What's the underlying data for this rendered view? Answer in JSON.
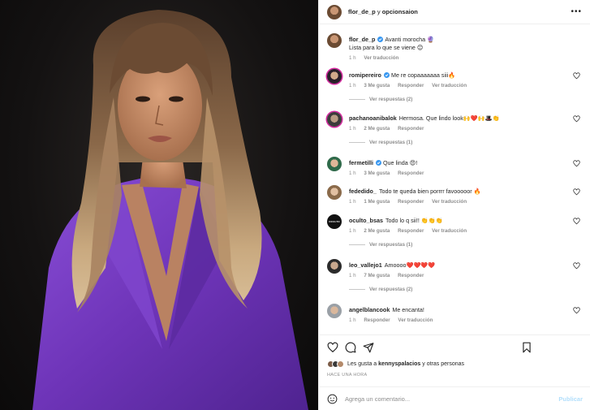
{
  "post": {
    "author": "flor_de_p",
    "collab_conjunction": "y",
    "collaborator": "opcionsaion",
    "more_icon": "more-horizontal-icon"
  },
  "caption": {
    "user": "flor_de_p",
    "text": "Avanti morocha 🔮",
    "text2": "Lista para lo que se viene 😊",
    "time": "1 h",
    "translate": "Ver traducción"
  },
  "comments": [
    {
      "user": "romipereiro",
      "verified": true,
      "text": "Me re copaaaaaaa siii🔥",
      "time": "1 h",
      "likes": "3 Me gusta",
      "reply": "Responder",
      "translate": "Ver traducción",
      "replies": "Ver respuestas (2)"
    },
    {
      "user": "pachanoanibalok",
      "verified": false,
      "text": "Hermosa. Que lindo look🙌❤️🙌🎩👏",
      "time": "1 h",
      "likes": "2 Me gusta",
      "reply": "Responder",
      "translate": "",
      "replies": "Ver respuestas (1)"
    },
    {
      "user": "fermetilli",
      "verified": true,
      "text": "Que linda 😍!",
      "time": "1 h",
      "likes": "3 Me gusta",
      "reply": "Responder",
      "translate": "",
      "replies": ""
    },
    {
      "user": "fededido_",
      "verified": false,
      "text": "Todo te queda bien porrrr favooooor 🔥",
      "time": "1 h",
      "likes": "1 Me gusta",
      "reply": "Responder",
      "translate": "Ver traducción",
      "replies": ""
    },
    {
      "user": "oculto_bsas",
      "verified": false,
      "text": "Todo lo q sii!! 👏👏👏",
      "time": "1 h",
      "likes": "2 Me gusta",
      "reply": "Responder",
      "translate": "Ver traducción",
      "replies": "Ver respuestas (1)"
    },
    {
      "user": "leo_vallejo1",
      "verified": false,
      "text": "Amoooo❤️❤️❤️❤️",
      "time": "1 h",
      "likes": "7 Me gusta",
      "reply": "Responder",
      "translate": "",
      "replies": "Ver respuestas (2)"
    },
    {
      "user": "angelblancook",
      "verified": false,
      "text": "Me encanta!",
      "time": "1 h",
      "likes": "",
      "reply": "Responder",
      "translate": "Ver traducción",
      "replies": ""
    }
  ],
  "actions": {
    "like_icon": "heart-icon",
    "comment_icon": "comment-icon",
    "share_icon": "paper-plane-icon",
    "save_icon": "bookmark-icon"
  },
  "likes": {
    "prefix": "Les gusta a",
    "user": "kennyspalacios",
    "suffix": "y otras personas"
  },
  "time_ago": "HACE UNA HORA",
  "add_comment": {
    "placeholder": "Agrega un comentario...",
    "post_label": "Publicar"
  },
  "colors": {
    "verified": "#3897f0",
    "muted": "#8e8e8e",
    "post_disabled": "#b2dffc",
    "outfit": "#7a3fc2"
  }
}
